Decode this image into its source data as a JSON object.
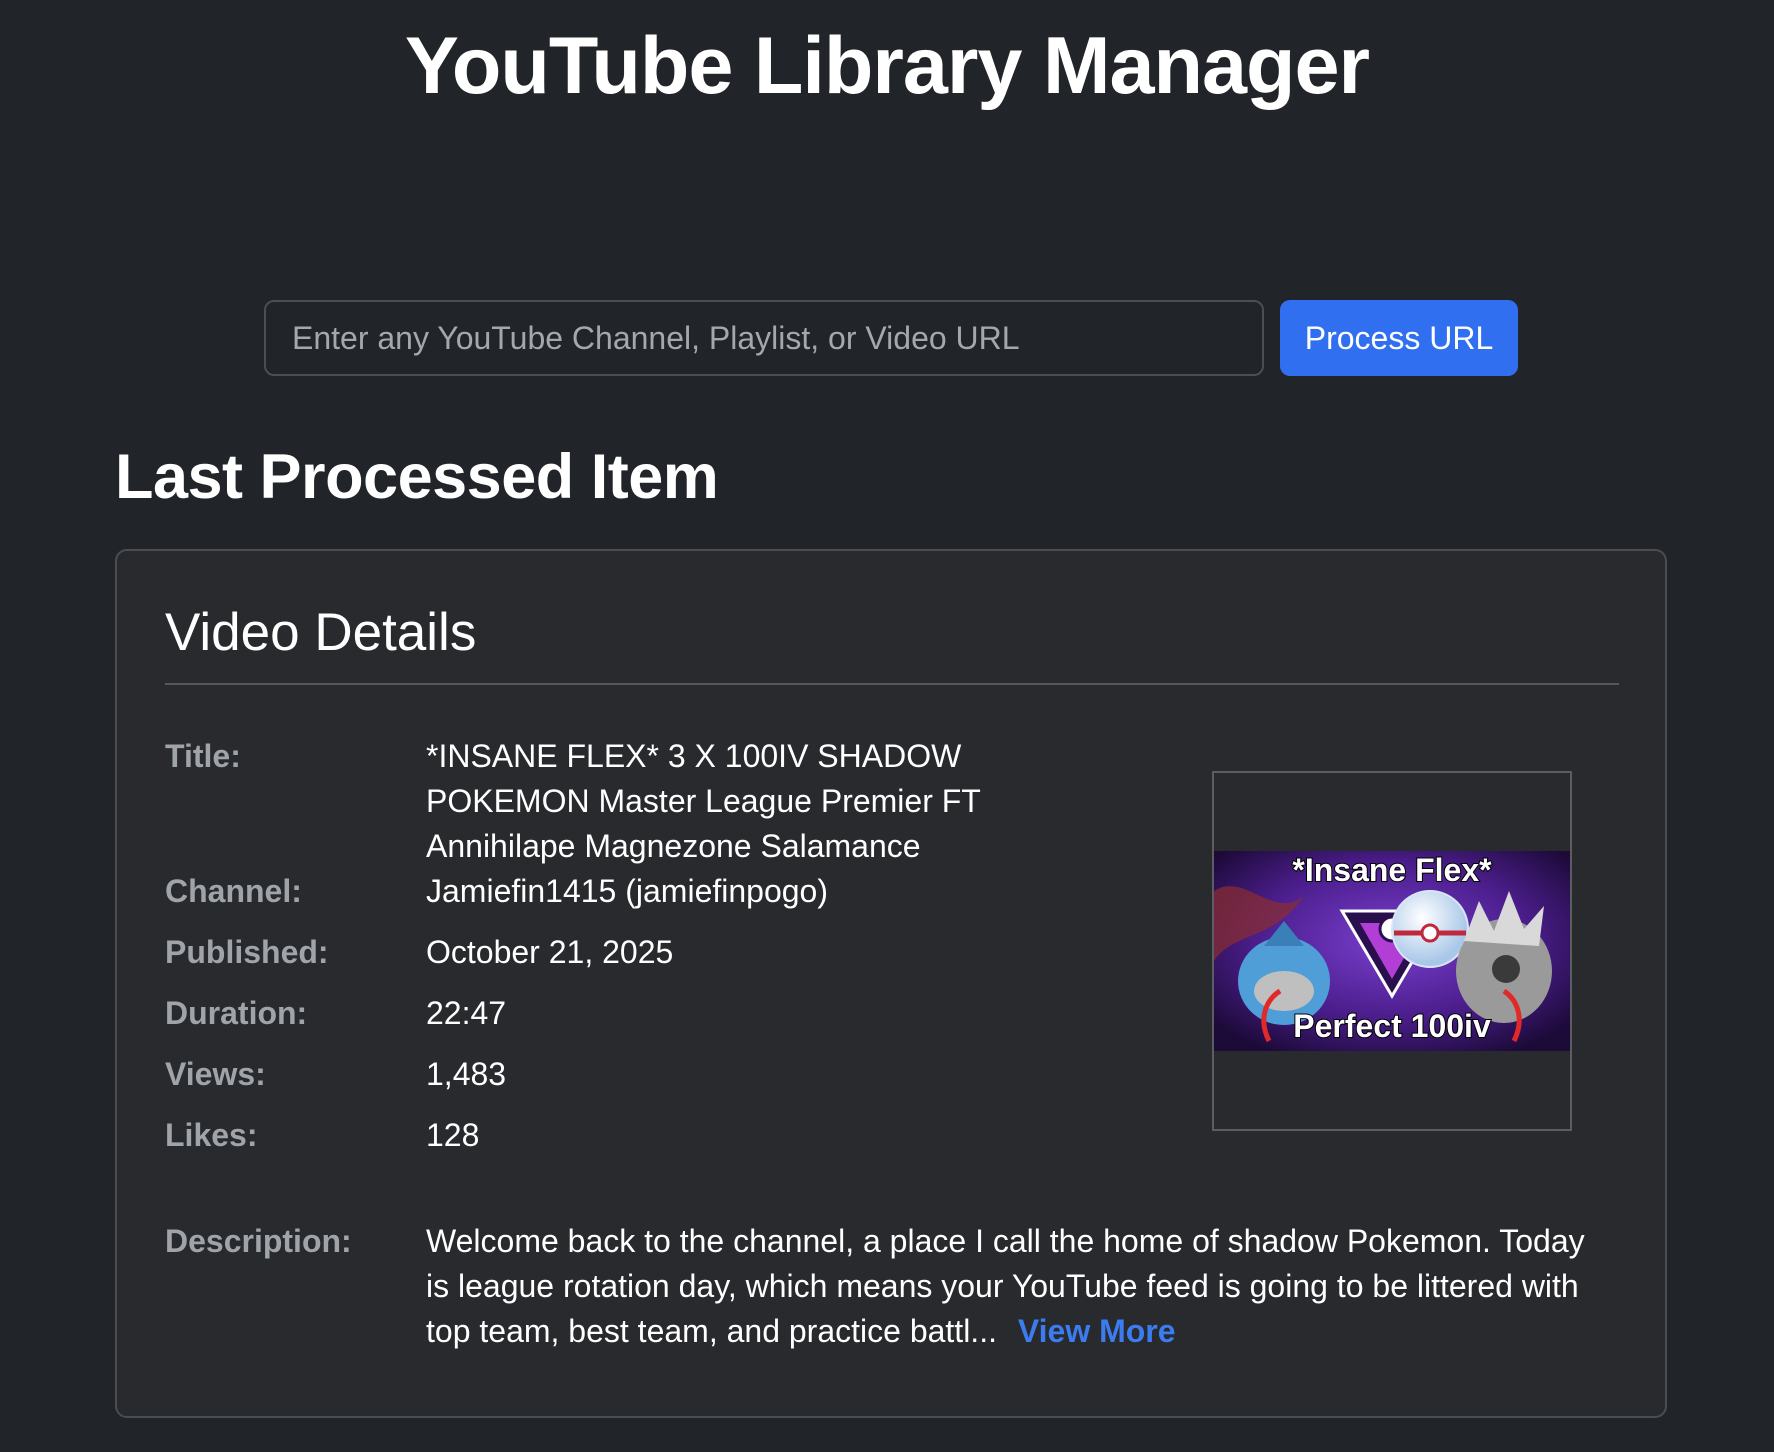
{
  "app": {
    "title": "YouTube Library Manager"
  },
  "search": {
    "placeholder": "Enter any YouTube Channel, Playlist, or Video URL",
    "value": "",
    "button_label": "Process URL"
  },
  "last_processed": {
    "heading": "Last Processed Item",
    "card_title": "Video Details",
    "fields": {
      "title_label": "Title:",
      "title_value": "*INSANE FLEX* 3 X 100IV SHADOW POKEMON Master League Premier FT Annihilape Magnezone Salamance",
      "channel_label": "Channel:",
      "channel_value": "Jamiefin1415 (jamiefinpogo)",
      "published_label": "Published:",
      "published_value": "October 21, 2025",
      "duration_label": "Duration:",
      "duration_value": "22:47",
      "views_label": "Views:",
      "views_value": "1,483",
      "likes_label": "Likes:",
      "likes_value": "128",
      "description_label": "Description:",
      "description_value": "Welcome back to the channel, a place I call the home of shadow Pokemon. Today is league rotation day, which means your YouTube feed is going to be littered with top team, best team, and practice battl...",
      "view_more_label": "View More"
    },
    "thumbnail": {
      "top_text": "*Insane Flex*",
      "bottom_text": "Perfect 100iv"
    }
  },
  "colors": {
    "background": "#212429",
    "card_background": "#292a2d",
    "accent": "#2f6ff0",
    "link": "#3b7df0",
    "label_text": "#9fa4aa",
    "thumbnail_purple": "#4a1d8a"
  }
}
